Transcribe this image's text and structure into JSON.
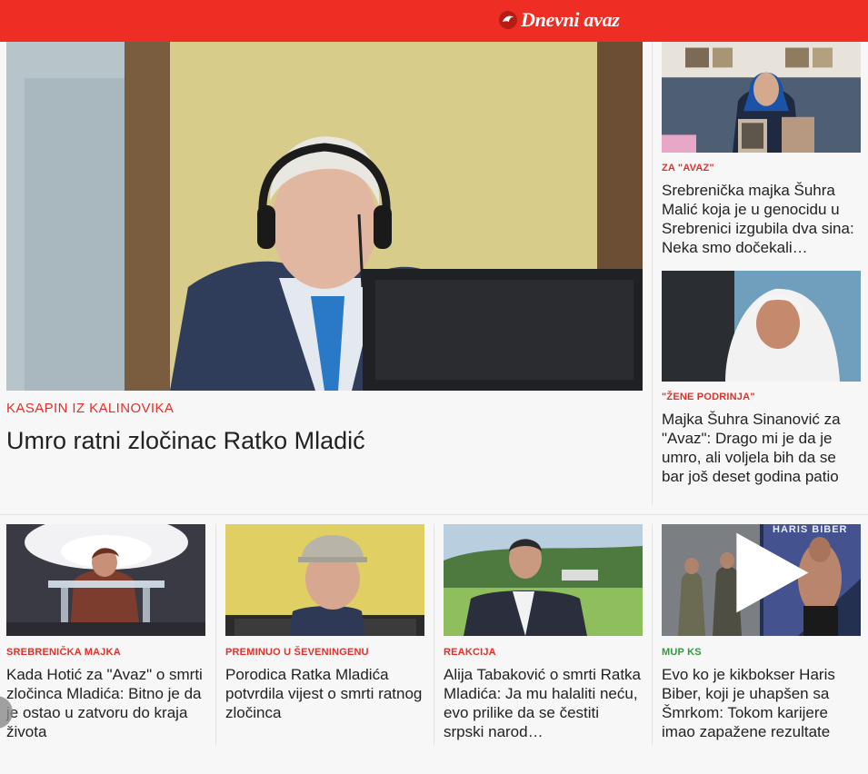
{
  "header": {
    "logo_text": "Dnevni avaz",
    "background_color": "#ee2e24"
  },
  "lead_story": {
    "kicker": "KASAPIN IZ KALINOVIKA",
    "title": "Umro ratni zločinac Ratko Mladić"
  },
  "side_stories": [
    {
      "kicker": "ZA \"AVAZ\"",
      "title": "Srebrenička majka Šuhra Malić koja je u genocidu u Srebrenici izgubila dva sina: Neka smo dočekali…"
    },
    {
      "kicker": "\"ŽENE PODRINJA\"",
      "title": "Majka Šuhra Sinanović za \"Avaz\": Drago mi je da je umro, ali voljela bih da se bar još deset godina patio"
    }
  ],
  "bottom_stories": [
    {
      "kicker": "SREBRENIČKA MAJKA",
      "title": "Kada Hotić za \"Avaz\" o smrti zločinca Mladića: Bitno je da je ostao u zatvoru do kraja života"
    },
    {
      "kicker": "PREMINUO U ŠEVENINGENU",
      "title": "Porodica Ratka Mladića potvrdila vijest o smrti ratnog zločinca"
    },
    {
      "kicker": "REAKCIJA",
      "title": "Alija Tabaković o smrti Ratka Mladića: Ja mu halaliti neću, evo prilike da se čestiti srpski narod…"
    },
    {
      "kicker": "MUP KS",
      "title": "Evo ko je kikbokser Haris Biber, koji je uhapšen sa Šmrkom: Tokom karijere imao zapažene rezultate",
      "image_overlay_text": "HARIS BIBER"
    }
  ],
  "colors": {
    "accent_red": "#e0312a",
    "accent_green": "#2f9c3c"
  }
}
